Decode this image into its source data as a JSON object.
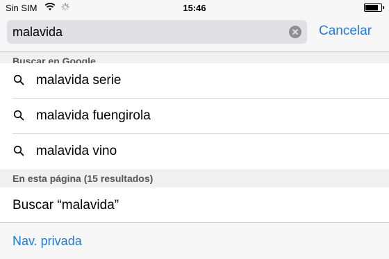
{
  "status_bar": {
    "carrier": "Sin SIM",
    "time": "15:46",
    "wifi_icon": "wifi-icon",
    "activity_icon": "activity-spinner-icon",
    "battery_icon": "battery-icon",
    "battery_level": 0.9
  },
  "search": {
    "value": "malavida",
    "clear_icon": "clear-icon",
    "cancel_label": "Cancelar"
  },
  "google_section": {
    "header": "Buscar en Google",
    "suggestions": [
      {
        "label": "malavida serie",
        "icon": "search-icon"
      },
      {
        "label": "malavida fuengirola",
        "icon": "search-icon"
      },
      {
        "label": "malavida vino",
        "icon": "search-icon"
      }
    ]
  },
  "page_section": {
    "header": "En esta página (15 resultados)",
    "find_label": "Buscar “malavida”"
  },
  "footer": {
    "private_label": "Nav. privada"
  },
  "colors": {
    "accent": "#1a7ae8",
    "bar_bg": "#f7f7f7",
    "field_bg": "#e0e0e4",
    "header_bg": "#f0f0f0"
  }
}
